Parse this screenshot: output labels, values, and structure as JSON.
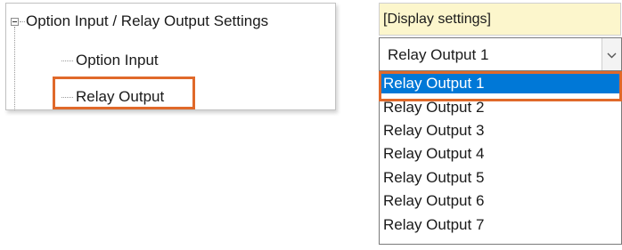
{
  "tree": {
    "root_label": "Option Input / Relay Output Settings",
    "children": [
      {
        "label": "Option Input"
      },
      {
        "label": "Relay Output"
      }
    ]
  },
  "settings": {
    "header": "[Display settings]",
    "combo": {
      "selected": "Relay Output 1",
      "icon": "chevron-down-icon"
    },
    "options": [
      "Relay Output 1",
      "Relay Output 2",
      "Relay Output 3",
      "Relay Output 4",
      "Relay Output 5",
      "Relay Output 6",
      "Relay Output 7"
    ]
  },
  "colors": {
    "highlight_outline": "#e0692a",
    "selection_bg": "#0078d7",
    "header_bg": "#fcf6cc"
  }
}
